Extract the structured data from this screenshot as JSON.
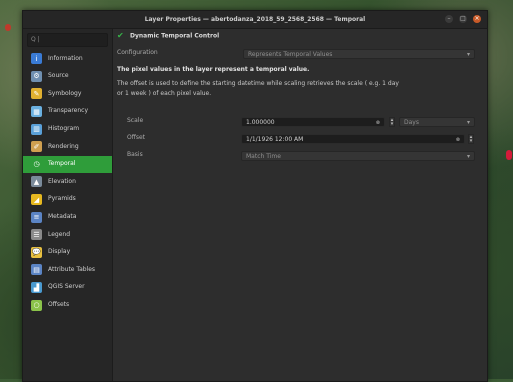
{
  "window": {
    "title": "Layer Properties — abertodanza_2018_59_2568_2568 — Temporal",
    "buttons": {
      "minimize": "–",
      "maximize": "□",
      "close": "×"
    }
  },
  "sidebar": {
    "search_value": "Q |",
    "items": [
      {
        "label": "Information",
        "icon": "information-icon",
        "color": "#3a7bd5",
        "glyph": "i"
      },
      {
        "label": "Source",
        "icon": "source-icon",
        "color": "#6f8fb0",
        "glyph": "⚙"
      },
      {
        "label": "Symbology",
        "icon": "symbology-icon",
        "color": "#e0b030",
        "glyph": "✎"
      },
      {
        "label": "Transparency",
        "icon": "transparency-icon",
        "color": "#6ab0e0",
        "glyph": "▦"
      },
      {
        "label": "Histogram",
        "icon": "histogram-icon",
        "color": "#5aa0d8",
        "glyph": "▥"
      },
      {
        "label": "Rendering",
        "icon": "rendering-icon",
        "color": "#d0a050",
        "glyph": "✐"
      },
      {
        "label": "Temporal",
        "icon": "temporal-clock-icon",
        "color": "#ffffff",
        "glyph": "◷"
      },
      {
        "label": "Elevation",
        "icon": "elevation-icon",
        "color": "#7a8a9a",
        "glyph": "▲"
      },
      {
        "label": "Pyramids",
        "icon": "pyramids-icon",
        "color": "#e6b820",
        "glyph": "◢"
      },
      {
        "label": "Metadata",
        "icon": "metadata-icon",
        "color": "#5b84c4",
        "glyph": "≡"
      },
      {
        "label": "Legend",
        "icon": "legend-icon",
        "color": "#8a8a8a",
        "glyph": "☰"
      },
      {
        "label": "Display",
        "icon": "display-icon",
        "color": "#e8c040",
        "glyph": "💬"
      },
      {
        "label": "Attribute Tables",
        "icon": "attribute-table-icon",
        "color": "#5b84c4",
        "glyph": "▤"
      },
      {
        "label": "QGIS Server",
        "icon": "qgis-server-icon",
        "color": "#4a9ad0",
        "glyph": "▟"
      },
      {
        "label": "Offsets",
        "icon": "offsets-icon",
        "color": "#8bc34a",
        "glyph": "○"
      }
    ]
  },
  "temporal": {
    "header": "Dynamic Temporal Control",
    "configuration_label": "Configuration",
    "configuration_value": "Represents Temporal Values",
    "desc_bold": "The pixel values in the layer represent a temporal value.",
    "desc_line1": "The offset is used to define the starting datetime while scaling retrieves the scale ( e.g. 1 day",
    "desc_line2": "or 1 week ) of each pixel value.",
    "scale_label": "Scale",
    "scale_value": "1.000000",
    "scale_unit": "Days",
    "offset_label": "Offset",
    "offset_value": "1/1/1926 12:00 AM",
    "basis_label": "Basis",
    "basis_value": "Match Time",
    "dropdown_arrow": "▾",
    "spin_up": "▴",
    "spin_down": "▾",
    "clear_glyph": "⊗"
  },
  "colors": {
    "accent_green": "#2f9d3a",
    "close_orange": "#c85a28"
  }
}
